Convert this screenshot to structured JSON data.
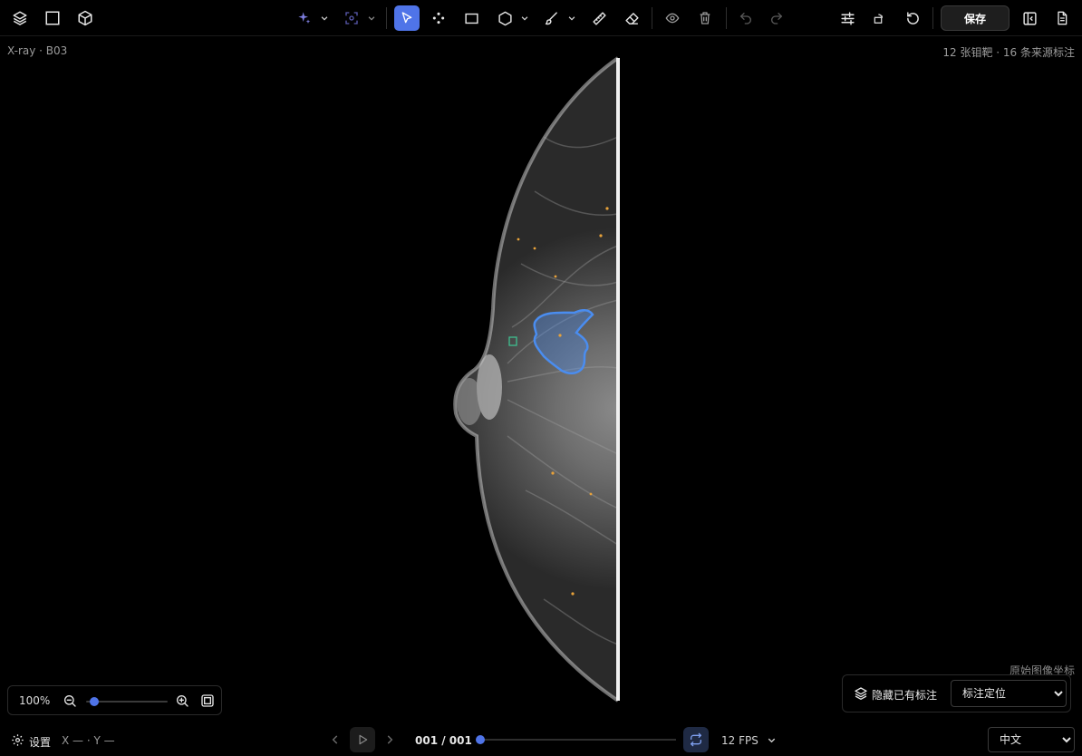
{
  "colors": {
    "accent": "#4f74e8",
    "segmentation": "#4a8df0",
    "point_marker": "#e8a23a",
    "bbox_marker": "#3fbf8f"
  },
  "toolbar": {
    "left_icons": [
      "layers-icon",
      "square-frame-icon",
      "cube-icon"
    ],
    "ai_icons": [
      "sparkle-icon",
      "ai-select-icon"
    ],
    "tool_icons": [
      "pointer-icon",
      "keypoint-icon",
      "rectangle-icon",
      "polygon-icon",
      "brush-icon",
      "ruler-icon",
      "eraser-icon"
    ],
    "view_icons": [
      "eye-icon",
      "trash-icon",
      "undo-icon",
      "redo-icon"
    ],
    "right_icons": [
      "sliders-icon",
      "rotate-square-icon",
      "refresh-icon"
    ],
    "save_label": "保存",
    "panel_icons": [
      "sidebar-toggle-icon",
      "document-icon"
    ],
    "active_tool": "pointer-icon"
  },
  "image": {
    "name": "X-ray · B03",
    "summary": "12 张钼靶 · 16 条来源标注"
  },
  "zoom": {
    "value": "100%",
    "level": 0.1
  },
  "coord_caption": "原始图像坐标",
  "annotation_panel": {
    "hide_label": "隐藏已有标注",
    "locate_selected": "标注定位",
    "locate_options": [
      "标注定位"
    ]
  },
  "bottom": {
    "settings_label": "设置",
    "coordinates": "X — · Y —",
    "frame_counter": "001 / 001",
    "frame_progress": 0,
    "fps": "12 FPS",
    "language_selected": "中文",
    "language_options": [
      "中文"
    ]
  }
}
